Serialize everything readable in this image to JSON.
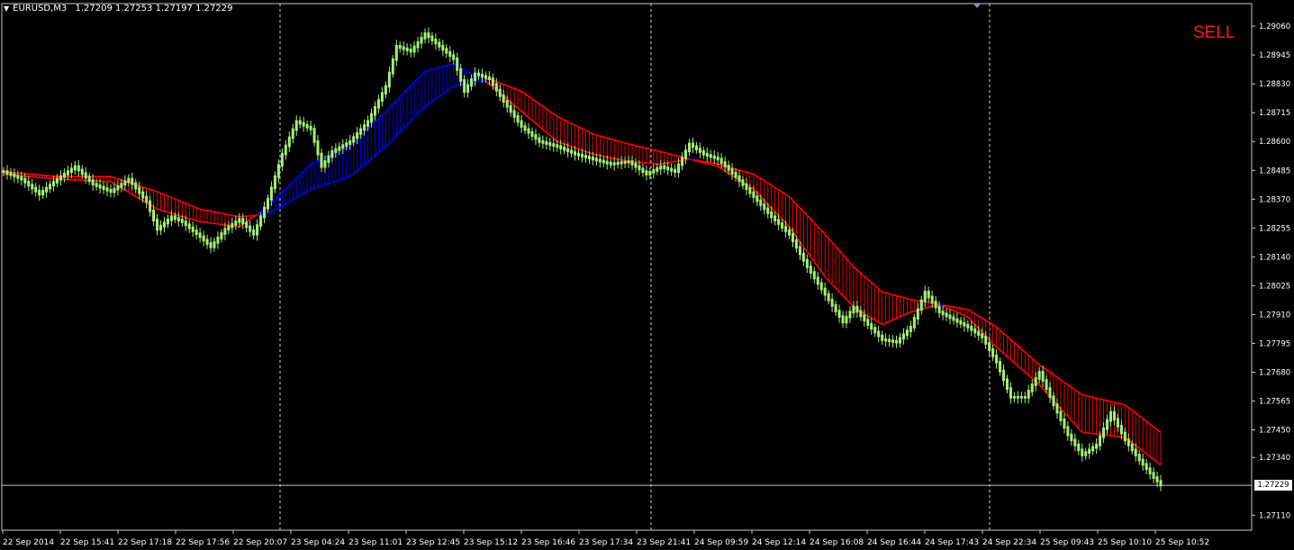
{
  "header": {
    "symbol": "EURUSD,M3",
    "open": "1.27209",
    "high": "1.27253",
    "low": "1.27197",
    "close": "1.27229"
  },
  "signal_label": "SELL",
  "current_price_label": "1.27229",
  "colors": {
    "background": "#000000",
    "candle": "#a6ee7a",
    "bear_ribbon": "#ff0000",
    "bull_ribbon": "#0000ff",
    "axis_text": "#ffffff",
    "signal": "#ff1a1a"
  },
  "chart_data": {
    "type": "line",
    "title": "",
    "xlabel": "",
    "ylabel": "",
    "ylim": [
      1.2705,
      1.2915
    ],
    "yticks": [
      "1.29060",
      "1.28945",
      "1.28830",
      "1.28715",
      "1.28600",
      "1.28485",
      "1.28370",
      "1.28255",
      "1.28140",
      "1.28025",
      "1.27910",
      "1.27795",
      "1.27680",
      "1.27565",
      "1.27450",
      "1.27340",
      "1.27229",
      "1.27110"
    ],
    "x_tick_labels": [
      "22 Sep 2014",
      "22 Sep 15:41",
      "22 Sep 17:18",
      "22 Sep 17:56",
      "22 Sep 20:07",
      "23 Sep 04:24",
      "23 Sep 11:01",
      "23 Sep 12:45",
      "23 Sep 15:12",
      "23 Sep 16:46",
      "23 Sep 17:34",
      "23 Sep 21:41",
      "24 Sep 09:59",
      "24 Sep 12:14",
      "24 Sep 16:08",
      "24 Sep 16:44",
      "24 Sep 17:43",
      "24 Sep 22:34",
      "25 Sep 09:43",
      "25 Sep 10:10",
      "25 Sep 10:52"
    ],
    "separator_ticks": [
      4,
      11,
      17
    ],
    "price": [
      [
        0,
        1.2848
      ],
      [
        5,
        1.2845
      ],
      [
        10,
        1.2839
      ],
      [
        15,
        1.2845
      ],
      [
        20,
        1.285
      ],
      [
        25,
        1.2843
      ],
      [
        30,
        1.284
      ],
      [
        35,
        1.2845
      ],
      [
        40,
        1.2836
      ],
      [
        43,
        1.2825
      ],
      [
        47,
        1.283
      ],
      [
        50,
        1.2828
      ],
      [
        55,
        1.2822
      ],
      [
        58,
        1.2818
      ],
      [
        62,
        1.2825
      ],
      [
        66,
        1.2829
      ],
      [
        70,
        1.2823
      ],
      [
        74,
        1.2837
      ],
      [
        78,
        1.2855
      ],
      [
        82,
        1.2868
      ],
      [
        86,
        1.2865
      ],
      [
        89,
        1.285
      ],
      [
        92,
        1.2856
      ],
      [
        97,
        1.286
      ],
      [
        102,
        1.2868
      ],
      [
        107,
        1.2882
      ],
      [
        110,
        1.2898
      ],
      [
        114,
        1.2896
      ],
      [
        118,
        1.2903
      ],
      [
        122,
        1.2898
      ],
      [
        126,
        1.2893
      ],
      [
        129,
        1.288
      ],
      [
        132,
        1.2887
      ],
      [
        136,
        1.2885
      ],
      [
        140,
        1.2876
      ],
      [
        145,
        1.2866
      ],
      [
        150,
        1.286
      ],
      [
        155,
        1.2858
      ],
      [
        160,
        1.2855
      ],
      [
        165,
        1.2853
      ],
      [
        170,
        1.2851
      ],
      [
        175,
        1.2852
      ],
      [
        180,
        1.2847
      ],
      [
        184,
        1.285
      ],
      [
        188,
        1.2848
      ],
      [
        192,
        1.2859
      ],
      [
        196,
        1.2855
      ],
      [
        200,
        1.2853
      ],
      [
        205,
        1.2846
      ],
      [
        210,
        1.2838
      ],
      [
        215,
        1.283
      ],
      [
        220,
        1.2823
      ],
      [
        225,
        1.281
      ],
      [
        230,
        1.2799
      ],
      [
        235,
        1.2788
      ],
      [
        238,
        1.2794
      ],
      [
        242,
        1.2787
      ],
      [
        246,
        1.2781
      ],
      [
        250,
        1.278
      ],
      [
        254,
        1.2786
      ],
      [
        258,
        1.28
      ],
      [
        262,
        1.2792
      ],
      [
        266,
        1.2789
      ],
      [
        270,
        1.2786
      ],
      [
        274,
        1.2782
      ],
      [
        278,
        1.2772
      ],
      [
        282,
        1.2758
      ],
      [
        286,
        1.2758
      ],
      [
        290,
        1.2768
      ],
      [
        294,
        1.2755
      ],
      [
        298,
        1.2743
      ],
      [
        302,
        1.2735
      ],
      [
        306,
        1.2739
      ],
      [
        310,
        1.2752
      ],
      [
        314,
        1.2741
      ],
      [
        318,
        1.2733
      ],
      [
        322,
        1.2726
      ],
      [
        324,
        1.2723
      ]
    ],
    "ribbon_fast": [
      [
        0,
        1.2847
      ],
      [
        15,
        1.2845
      ],
      [
        30,
        1.2844
      ],
      [
        43,
        1.2833
      ],
      [
        55,
        1.2828
      ],
      [
        66,
        1.2826
      ],
      [
        74,
        1.2834
      ],
      [
        86,
        1.2851
      ],
      [
        97,
        1.2858
      ],
      [
        107,
        1.2872
      ],
      [
        118,
        1.2888
      ],
      [
        126,
        1.2891
      ],
      [
        136,
        1.2883
      ],
      [
        145,
        1.2872
      ],
      [
        155,
        1.286
      ],
      [
        165,
        1.2855
      ],
      [
        175,
        1.2852
      ],
      [
        184,
        1.2851
      ],
      [
        192,
        1.2853
      ],
      [
        200,
        1.285
      ],
      [
        210,
        1.2841
      ],
      [
        220,
        1.2826
      ],
      [
        230,
        1.2806
      ],
      [
        238,
        1.2794
      ],
      [
        246,
        1.2787
      ],
      [
        254,
        1.2792
      ],
      [
        262,
        1.2795
      ],
      [
        270,
        1.279
      ],
      [
        278,
        1.2778
      ],
      [
        290,
        1.2763
      ],
      [
        302,
        1.2744
      ],
      [
        314,
        1.2742
      ],
      [
        324,
        1.2731
      ]
    ],
    "ribbon_slow": [
      [
        0,
        1.2848
      ],
      [
        15,
        1.2846
      ],
      [
        30,
        1.2846
      ],
      [
        43,
        1.284
      ],
      [
        55,
        1.2833
      ],
      [
        66,
        1.283
      ],
      [
        74,
        1.2831
      ],
      [
        86,
        1.2841
      ],
      [
        97,
        1.2846
      ],
      [
        107,
        1.2858
      ],
      [
        118,
        1.2874
      ],
      [
        126,
        1.2882
      ],
      [
        136,
        1.2885
      ],
      [
        145,
        1.288
      ],
      [
        155,
        1.287
      ],
      [
        165,
        1.2863
      ],
      [
        175,
        1.2859
      ],
      [
        184,
        1.2856
      ],
      [
        192,
        1.2853
      ],
      [
        200,
        1.2851
      ],
      [
        210,
        1.2847
      ],
      [
        220,
        1.2838
      ],
      [
        230,
        1.2823
      ],
      [
        238,
        1.281
      ],
      [
        246,
        1.28
      ],
      [
        254,
        1.2797
      ],
      [
        262,
        1.2795
      ],
      [
        270,
        1.2793
      ],
      [
        278,
        1.2786
      ],
      [
        290,
        1.2771
      ],
      [
        302,
        1.2759
      ],
      [
        314,
        1.2755
      ],
      [
        324,
        1.2744
      ]
    ],
    "current_price": 1.27229
  }
}
